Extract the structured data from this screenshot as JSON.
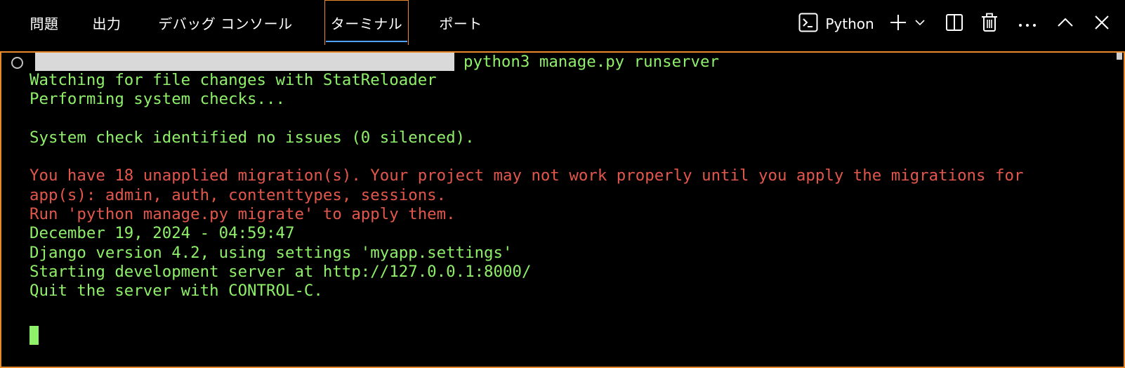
{
  "tabs": [
    {
      "label": "問題"
    },
    {
      "label": "出力"
    },
    {
      "label": "デバッグ コンソール"
    },
    {
      "label": "ターミナル",
      "active": true
    },
    {
      "label": "ポート"
    }
  ],
  "toolbar": {
    "profile_label": "Python",
    "icons": [
      "terminal-prompt-icon",
      "plus-icon",
      "chevron-down-icon",
      "split-icon",
      "trash-icon",
      "more-icon",
      "chevron-up-icon",
      "close-icon"
    ]
  },
  "terminal": {
    "command": "python3 manage.py runserver",
    "lines": [
      {
        "text": "Watching for file changes with StatReloader",
        "color": "green"
      },
      {
        "text": "Performing system checks...",
        "color": "green"
      },
      {
        "text": "",
        "color": "green"
      },
      {
        "text": "System check identified no issues (0 silenced).",
        "color": "green"
      },
      {
        "text": "",
        "color": "green"
      },
      {
        "text": "You have 18 unapplied migration(s). Your project may not work properly until you apply the migrations for",
        "color": "red"
      },
      {
        "text": "app(s): admin, auth, contenttypes, sessions.",
        "color": "red"
      },
      {
        "text": "Run 'python manage.py migrate' to apply them.",
        "color": "red"
      },
      {
        "text": "December 19, 2024 - 04:59:47",
        "color": "green"
      },
      {
        "text": "Django version 4.2, using settings 'myapp.settings'",
        "color": "green"
      },
      {
        "text": "Starting development server at http://127.0.0.1:8000/",
        "color": "green"
      },
      {
        "text": "Quit the server with CONTROL-C.",
        "color": "green"
      }
    ]
  },
  "colors": {
    "accent_border": "#e8892c",
    "active_tab_underline": "#4fa3ff",
    "terminal_green": "#8ff069",
    "terminal_red": "#e2574c",
    "background": "#000000"
  }
}
